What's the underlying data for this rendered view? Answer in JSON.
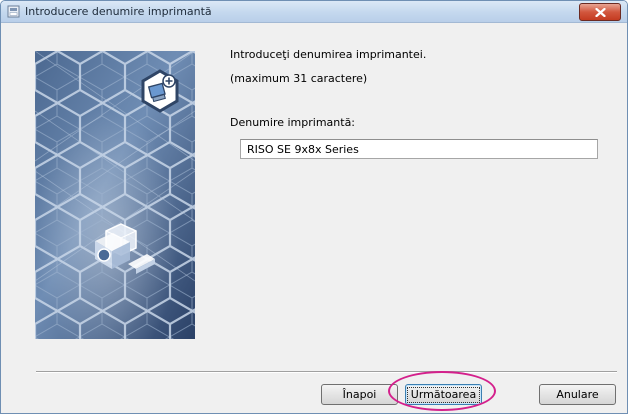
{
  "window": {
    "title": "Introducere denumire imprimantă",
    "title_icon": "printer-setup-icon",
    "close_icon": "close-icon"
  },
  "banner": {
    "image": "hexagon-network-illustration",
    "badge_icon": "computer-add-icon",
    "device_icon": "printer-cube-icon",
    "colors": {
      "dark": "#2c4366",
      "mid": "#5c7aa2",
      "light": "#b2c6de"
    }
  },
  "content": {
    "prompt": "Introduceţi denumirea imprimantei.",
    "hint": "(maximum 31 caractere)",
    "field_label": "Denumire imprimantă:",
    "printer_name_value": "RISO SE 9x8x Series"
  },
  "buttons": {
    "back": "Înapoi",
    "next": "Următoarea",
    "cancel": "Anulare"
  },
  "annotation": {
    "color": "#d4208c"
  }
}
